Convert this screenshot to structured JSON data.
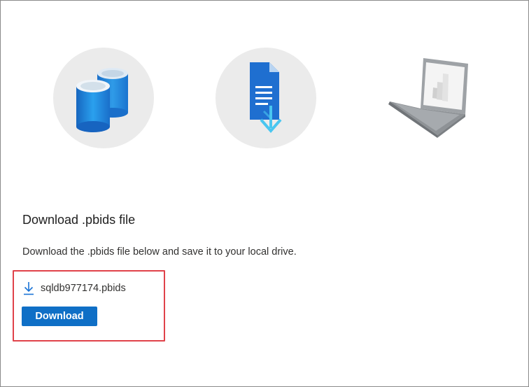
{
  "section": {
    "title": "Download .pbids file",
    "description": "Download the .pbids file below and save it to your local drive."
  },
  "file": {
    "name": "sqldb977174.pbids",
    "icon": "download-arrow-icon"
  },
  "actions": {
    "download_label": "Download"
  },
  "illustrations": [
    {
      "icon": "database-icon"
    },
    {
      "icon": "document-download-icon"
    },
    {
      "icon": "laptop-icon"
    }
  ],
  "colors": {
    "button": "#0f6fc6",
    "highlight_border": "#e0424a",
    "circle_bg": "#ebebeb",
    "accent_blue": "#1a8fe0"
  }
}
